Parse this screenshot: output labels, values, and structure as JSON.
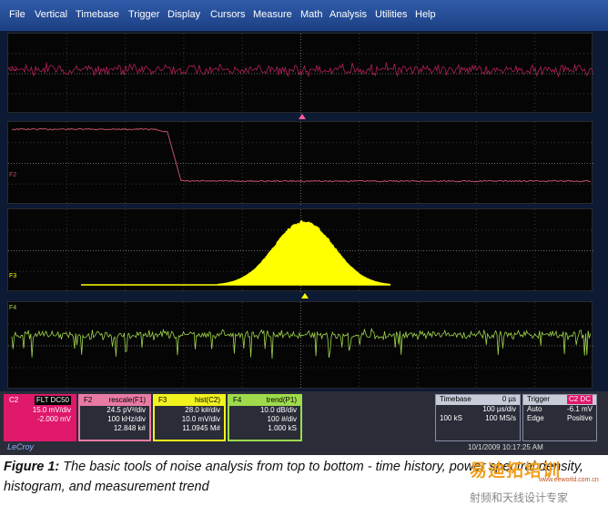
{
  "menu": [
    "File",
    "Vertical",
    "Timebase",
    "Trigger",
    "Display",
    "Cursors",
    "Measure",
    "Math",
    "Analysis",
    "Utilities",
    "Help"
  ],
  "trace_labels": {
    "c2": "C2",
    "f2": "F2",
    "f3": "F3",
    "f4": "F4"
  },
  "colors": {
    "c2": "#b0205a",
    "f2": "#c04f6a",
    "f3": "#ffff00",
    "f4": "#9fd64a",
    "marker": "#ff5f9a",
    "menubar": "#2350a0"
  },
  "channels": {
    "c2": {
      "label": "C2",
      "tag": "FLT DC50",
      "row1": "15.0 mV/div",
      "row2": "-2.000 mV",
      "bg": "#e0186c"
    },
    "f2": {
      "label": "F2",
      "tag": "rescale(F1)",
      "row1": "24.5 pV²/div",
      "row2": "100 kHz/div",
      "row3": "12.848 k#",
      "bg": "#e87aa4"
    },
    "f3": {
      "label": "F3",
      "tag": "hist(C2)",
      "row1": "28.0 k#/div",
      "row2": "10.0 mV/div",
      "row3": "11.0945 M#",
      "bg": "#f2f21e"
    },
    "f4": {
      "label": "F4",
      "tag": "trend(P1)",
      "row1": "10.0 dB/div",
      "row2": "100 #/div",
      "row3": "1.000 kS",
      "bg": "#9edb4c"
    }
  },
  "timebase": {
    "label": "Timebase",
    "offset": "0 µs",
    "r1": "100 µs/div",
    "r2l": "100 kS",
    "r2r": "100 MS/s"
  },
  "trigger": {
    "label": "Trigger",
    "tag": "C2 DC",
    "r1l": "Auto",
    "r1r": "-6.1 mV",
    "r2l": "Edge",
    "r2r": "Positive"
  },
  "logo": "LeCroy",
  "datetime": "10/1/2009 10:17:25 AM",
  "caption": {
    "lead": "Figure 1:",
    "text": "The basic tools of noise analysis from top to bottom - time history, power spectral density, histogram, and measurement trend"
  },
  "watermark": {
    "brand": "易迪拓培训",
    "site": "www.eeworld.com.cn",
    "cn": "射频和天线设计专家"
  }
}
